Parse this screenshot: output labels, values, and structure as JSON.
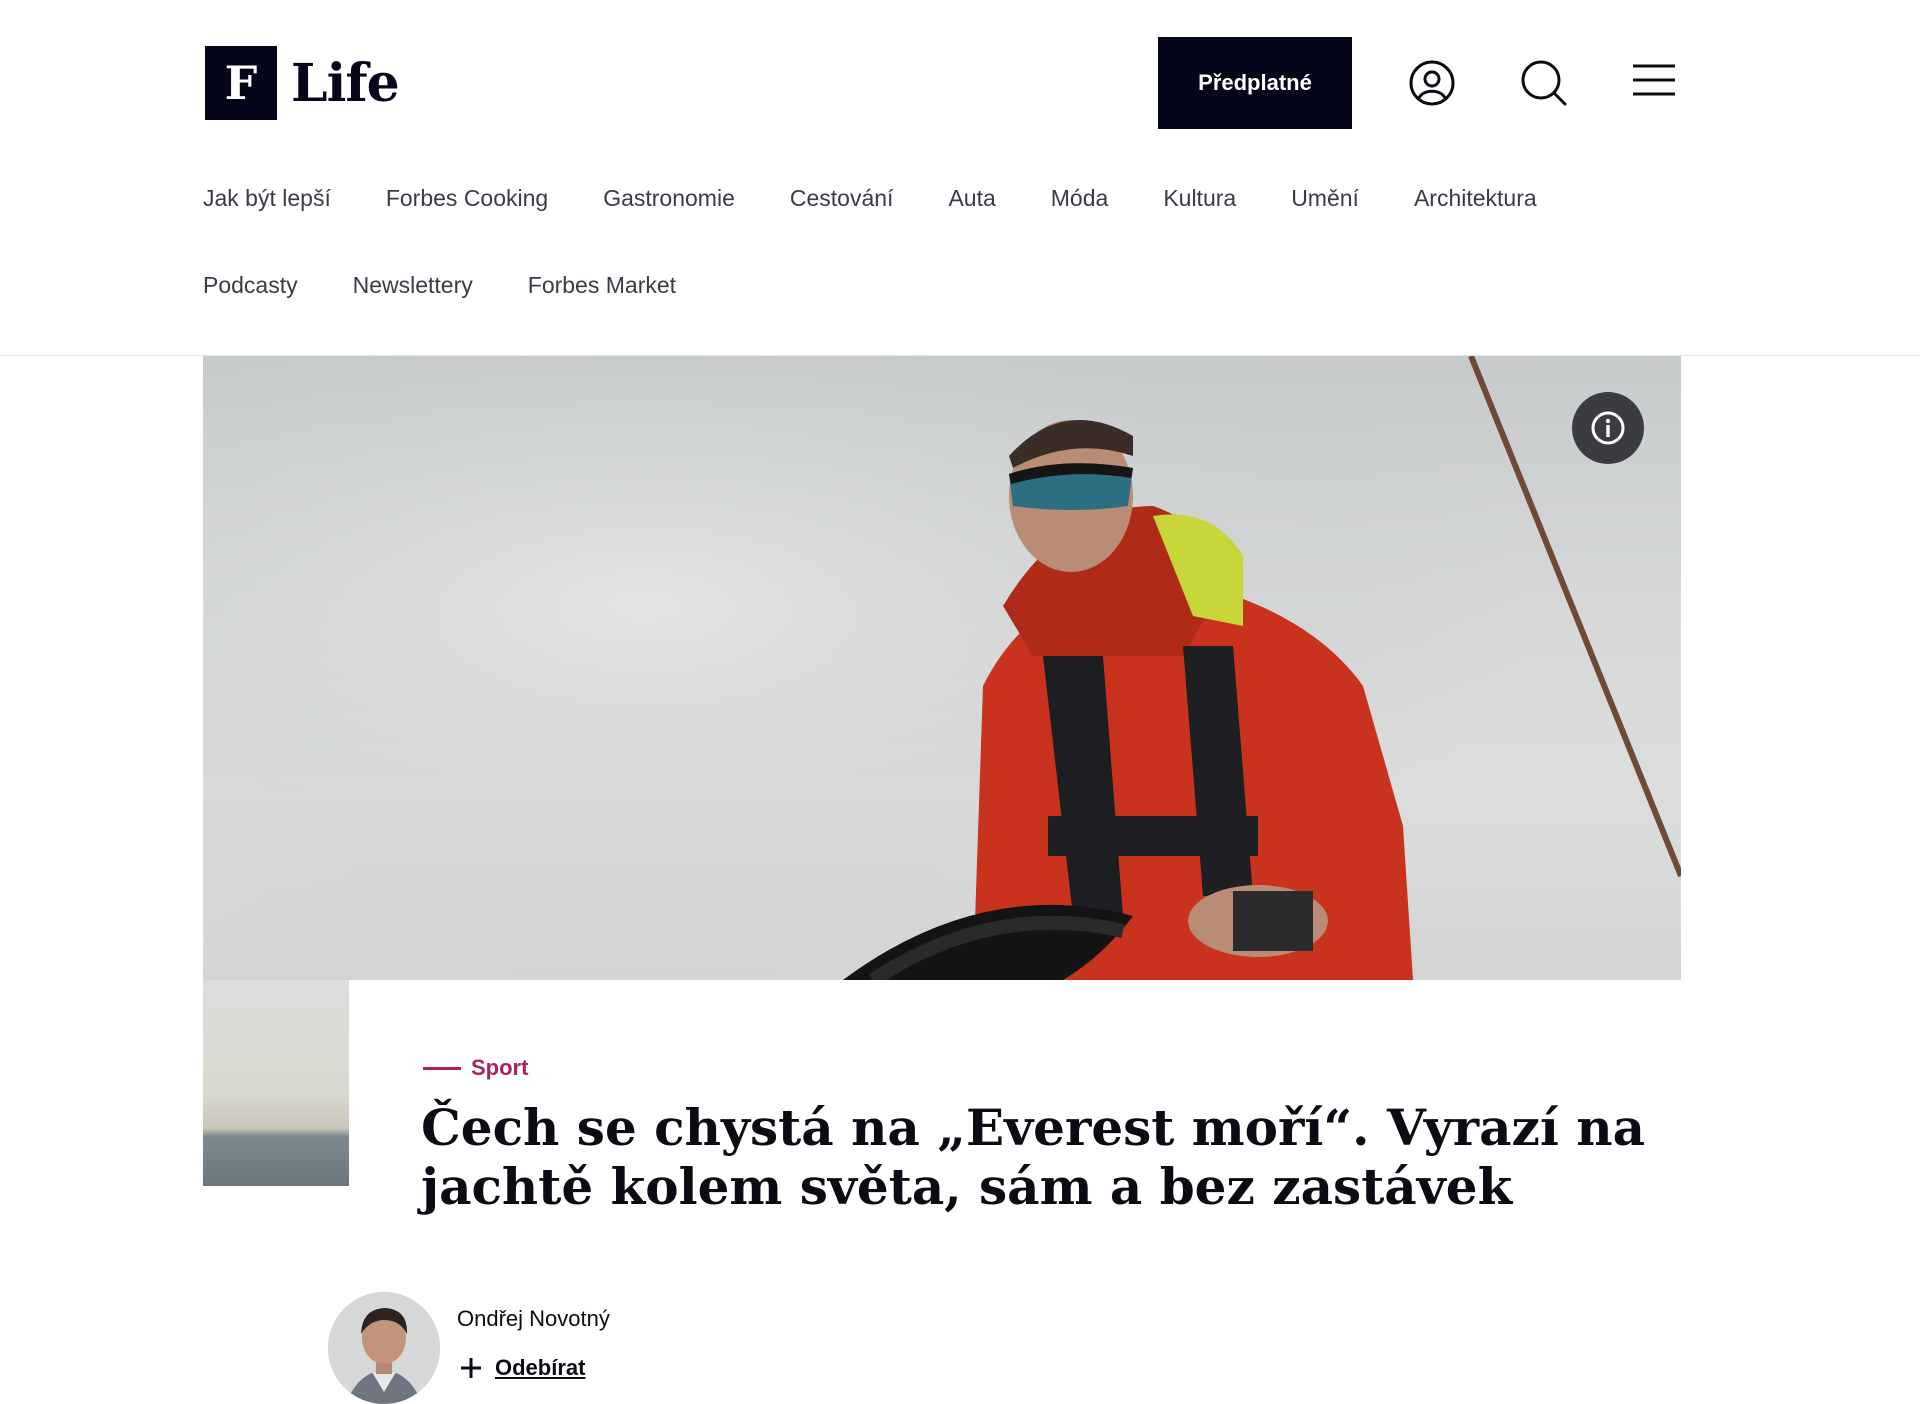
{
  "header": {
    "logo_letter": "F",
    "logo_word": "Life",
    "subscribe_label": "Předplatné",
    "icons": [
      "user-account-icon",
      "search-icon",
      "hamburger-menu-icon"
    ]
  },
  "nav": {
    "row1": [
      "Jak být lepší",
      "Forbes Cooking",
      "Gastronomie",
      "Cestování",
      "Auta",
      "Móda",
      "Kultura",
      "Umění",
      "Architektura"
    ],
    "row2": [
      "Podcasty",
      "Newslettery",
      "Forbes Market"
    ]
  },
  "hero": {
    "info_icon": "info-icon"
  },
  "article": {
    "category": "Sport",
    "headline": "Čech se chystá na „Everest moří“. Vyrazí na jachtě kolem světa, sám a bez zastávek"
  },
  "author": {
    "name": "Ondřej Novotný",
    "follow_label": "Odebírat"
  },
  "colors": {
    "brand_dark": "#05061a",
    "accent": "#a8245a"
  }
}
